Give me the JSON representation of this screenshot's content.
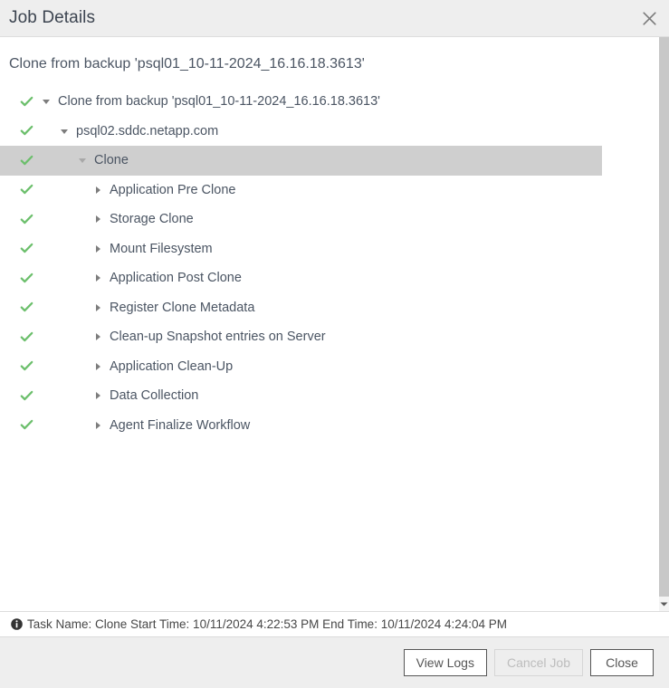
{
  "dialog": {
    "title": "Job Details",
    "close_icon": "close-icon",
    "heading": "Clone from backup 'psql01_10-11-2024_16.16.18.3613'"
  },
  "tree": {
    "nodes": [
      {
        "label": "Clone from backup 'psql01_10-11-2024_16.16.18.3613'",
        "level": 0,
        "status": "success",
        "caret": "caret-down",
        "expanded": true,
        "selected": false
      },
      {
        "label": "psql02.sddc.netapp.com",
        "level": 1,
        "status": "success",
        "caret": "caret-down",
        "expanded": true,
        "selected": false
      },
      {
        "label": "Clone",
        "level": 2,
        "status": "success",
        "caret": "caret-down",
        "expanded": true,
        "selected": true
      },
      {
        "label": "Application Pre Clone",
        "level": 3,
        "status": "success",
        "caret": "caret-right",
        "expanded": false,
        "selected": false
      },
      {
        "label": "Storage Clone",
        "level": 3,
        "status": "success",
        "caret": "caret-right",
        "expanded": false,
        "selected": false
      },
      {
        "label": "Mount Filesystem",
        "level": 3,
        "status": "success",
        "caret": "caret-right",
        "expanded": false,
        "selected": false
      },
      {
        "label": "Application Post Clone",
        "level": 3,
        "status": "success",
        "caret": "caret-right",
        "expanded": false,
        "selected": false
      },
      {
        "label": "Register Clone Metadata",
        "level": 3,
        "status": "success",
        "caret": "caret-right",
        "expanded": false,
        "selected": false
      },
      {
        "label": "Clean-up Snapshot entries on Server",
        "level": 3,
        "status": "success",
        "caret": "caret-right",
        "expanded": false,
        "selected": false
      },
      {
        "label": "Application Clean-Up",
        "level": 3,
        "status": "success",
        "caret": "caret-right",
        "expanded": false,
        "selected": false
      },
      {
        "label": "Data Collection",
        "level": 3,
        "status": "success",
        "caret": "caret-right",
        "expanded": false,
        "selected": false
      },
      {
        "label": "Agent Finalize Workflow",
        "level": 3,
        "status": "success",
        "caret": "caret-right",
        "expanded": false,
        "selected": false
      }
    ]
  },
  "statusbar": {
    "icon": "info-icon",
    "text": "Task Name: Clone Start Time: 10/11/2024 4:22:53 PM End Time: 10/11/2024 4:24:04 PM"
  },
  "footer": {
    "buttons": [
      {
        "label": "View Logs",
        "disabled": false
      },
      {
        "label": "Cancel Job",
        "disabled": true
      },
      {
        "label": "Close",
        "disabled": false
      }
    ]
  },
  "scrollbar": {
    "arrow_down_icon": "chevron-down-icon"
  },
  "colors": {
    "success_check": "#6cbf6c",
    "selected_row": "#cfcfcf",
    "titlebar_bg": "#eeeeee",
    "text": "#4b5563"
  }
}
